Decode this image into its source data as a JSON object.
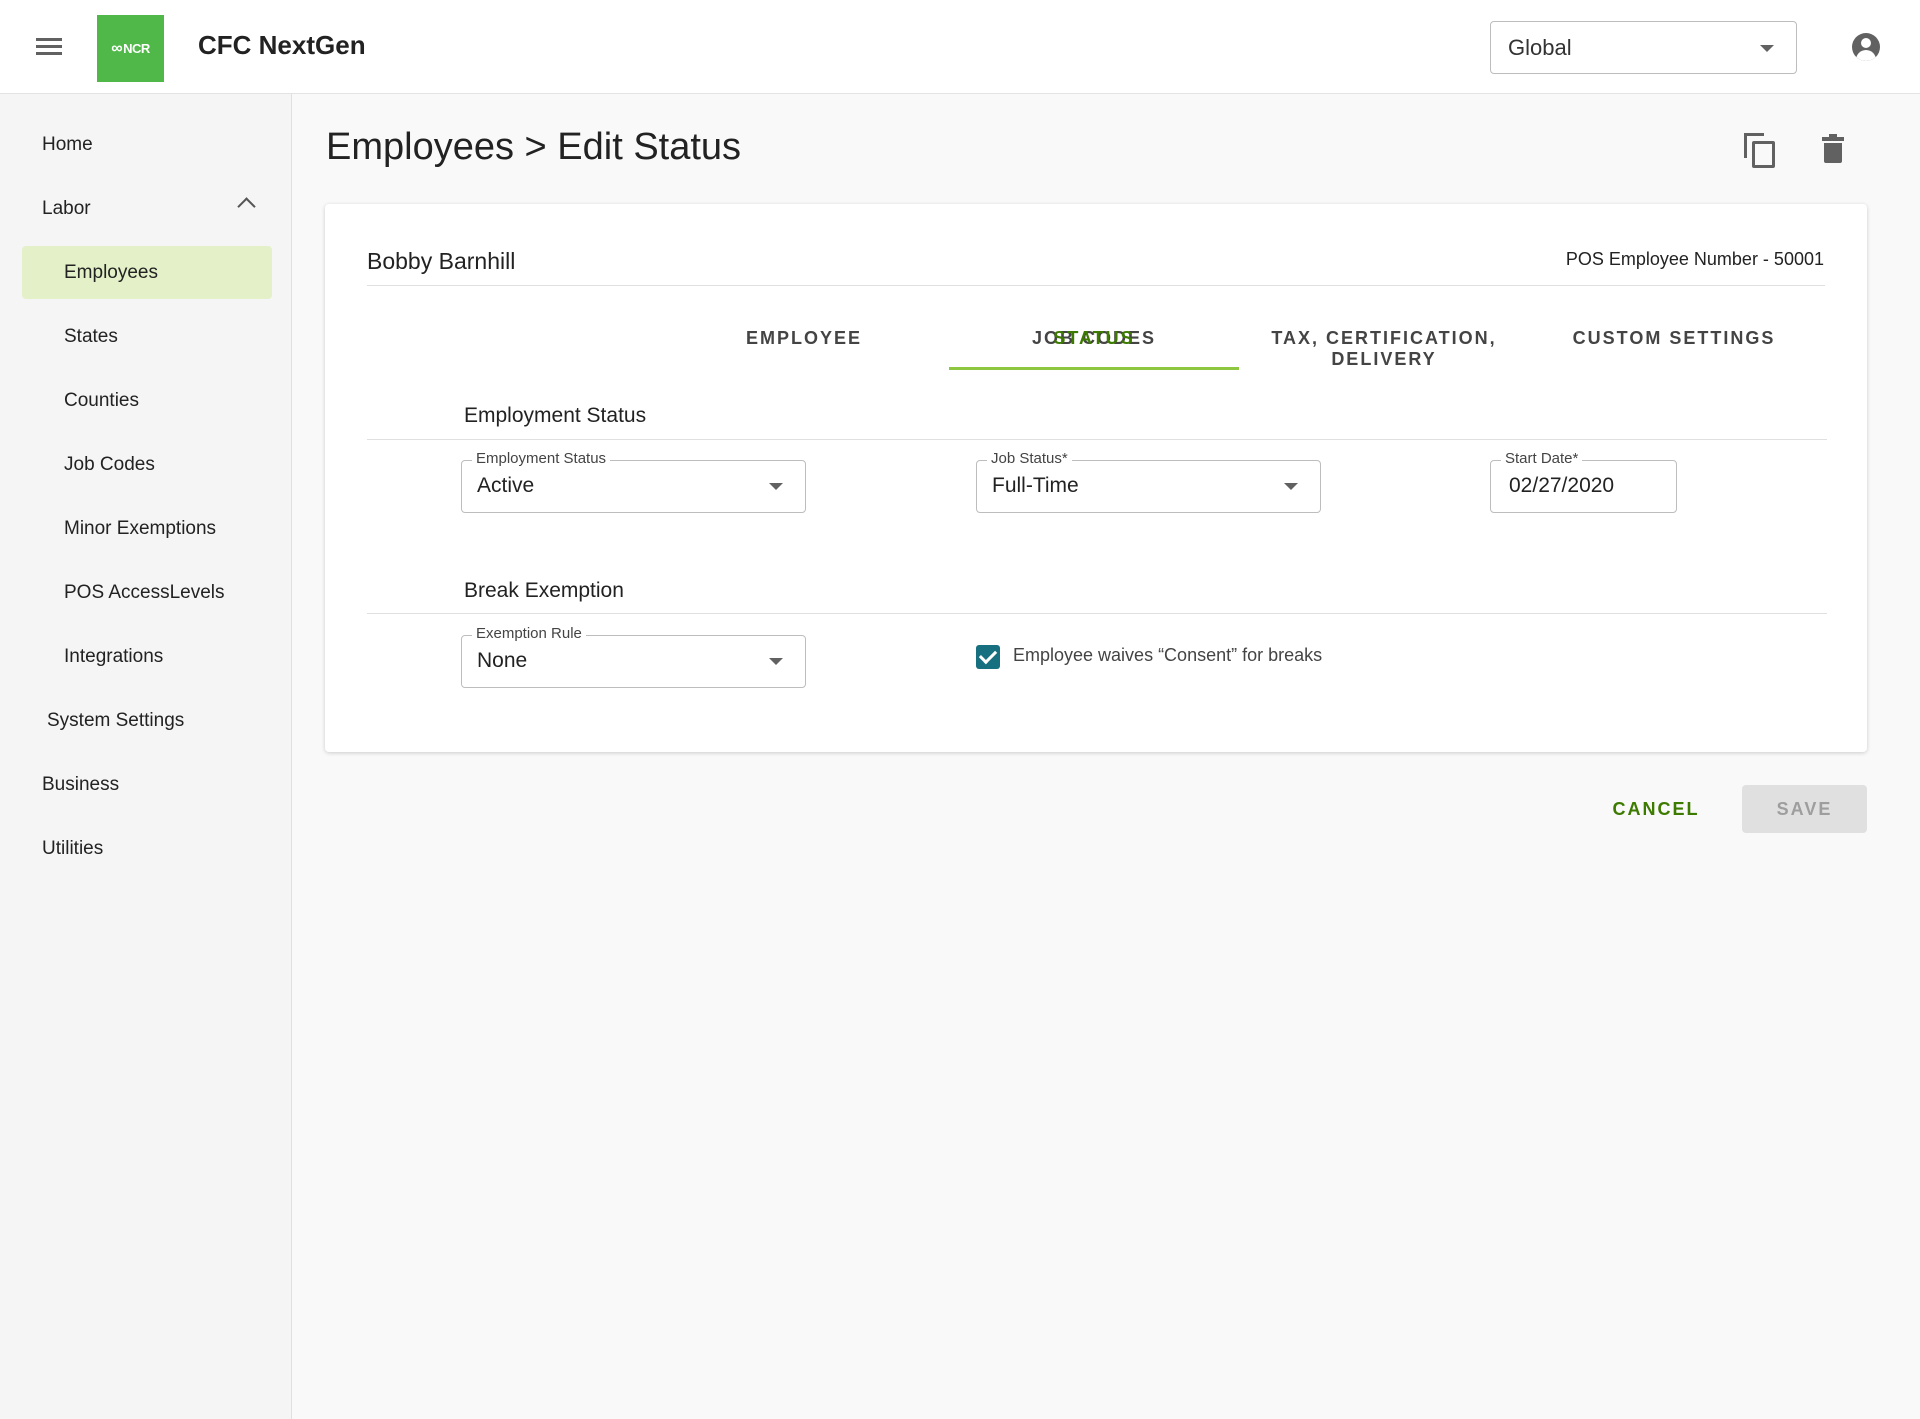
{
  "app": {
    "title": "CFC NextGen",
    "logo_text": "NCR",
    "scope_select": {
      "value": "Global"
    }
  },
  "sidebar": {
    "items": [
      {
        "label": "Home"
      },
      {
        "label": "Labor",
        "expanded": true
      },
      {
        "label": "Employees",
        "active": true
      },
      {
        "label": "States"
      },
      {
        "label": "Counties"
      },
      {
        "label": "Job Codes"
      },
      {
        "label": "Minor Exemptions"
      },
      {
        "label": "POS AccessLevels"
      },
      {
        "label": "Integrations"
      },
      {
        "label": "System Settings"
      },
      {
        "label": "Business"
      },
      {
        "label": "Utilities"
      }
    ]
  },
  "page": {
    "title": "Employees > Edit Status"
  },
  "employee": {
    "name": "Bobby Barnhill",
    "pos_number": "POS Employee Number - 50001"
  },
  "tabs": [
    {
      "label": "EMPLOYEE"
    },
    {
      "label": "JOB CODES"
    },
    {
      "label": "STATUS",
      "active": true
    },
    {
      "label": "TAX, CERTIFICATION, DELIVERY"
    },
    {
      "label": "CUSTOM SETTINGS"
    }
  ],
  "employment_section": {
    "title": "Employment Status",
    "employment_status": {
      "label": "Employment Status",
      "value": "Active"
    },
    "job_status": {
      "label": "Job Status*",
      "value": "Full-Time"
    },
    "start_date": {
      "label": "Start Date*",
      "value": "02/27/2020"
    }
  },
  "break_section": {
    "title": "Break Exemption",
    "exemption_rule": {
      "label": "Exemption Rule",
      "value": "None"
    },
    "waive_consent": {
      "label": "Employee waives “Consent” for breaks",
      "checked": true
    }
  },
  "actions": {
    "cancel": "CANCEL",
    "save": "SAVE"
  },
  "colors": {
    "brand_green": "#4fb848",
    "active_tab_text": "#3c7a00",
    "active_tab_underline": "#8dc63f",
    "active_nav_bg": "#e3f0c8",
    "checkbox": "#17707f"
  }
}
